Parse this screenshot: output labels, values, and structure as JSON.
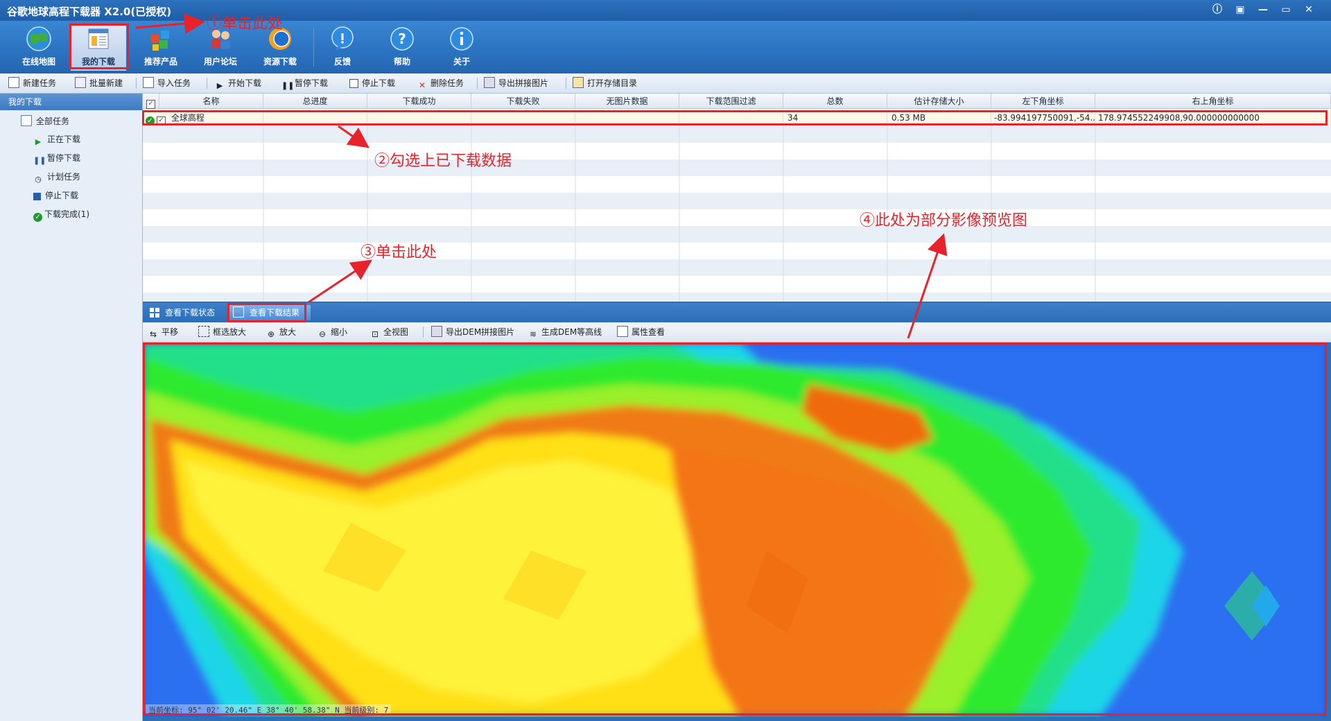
{
  "window": {
    "title": "谷歌地球高程下载器 X2.0(已授权)",
    "controls": [
      "info-icon",
      "skin-icon",
      "minimize-icon",
      "maximize-icon",
      "close-icon"
    ]
  },
  "main_toolbar": {
    "buttons": [
      {
        "label": "在线地图",
        "icon": "globe-icon"
      },
      {
        "label": "我的下载",
        "icon": "download-list-icon"
      },
      {
        "label": "推荐产品",
        "icon": "cubes-icon"
      },
      {
        "label": "用户论坛",
        "icon": "users-icon"
      },
      {
        "label": "资源下载",
        "icon": "resource-icon"
      },
      {
        "label": "反馈",
        "icon": "feedback-icon"
      },
      {
        "label": "帮助",
        "icon": "help-icon"
      },
      {
        "label": "关于",
        "icon": "about-icon"
      }
    ]
  },
  "task_toolbar": {
    "buttons": [
      "新建任务",
      "批量新建",
      "导入任务",
      "开始下载",
      "暂停下载",
      "停止下载",
      "删除任务",
      "导出拼接图片",
      "打开存储目录"
    ]
  },
  "left_panel": {
    "header": "我的下载",
    "tree": [
      {
        "label": "全部任务",
        "icon": "list-icon"
      },
      {
        "label": "正在下载",
        "icon": "play-icon"
      },
      {
        "label": "暂停下载",
        "icon": "pause-icon"
      },
      {
        "label": "计划任务",
        "icon": "clock-icon"
      },
      {
        "label": "停止下载",
        "icon": "stop-icon"
      },
      {
        "label": "下载完成(1)",
        "icon": "check-circle-icon"
      }
    ]
  },
  "task_grid": {
    "columns": [
      "名称",
      "总进度",
      "下载成功",
      "下载失败",
      "无图片数据",
      "下载范围过滤",
      "总数",
      "估计存储大小",
      "左下角坐标",
      "右上角坐标"
    ],
    "rows": [
      {
        "name": "全球高程",
        "progress": "",
        "success": "",
        "failed": "",
        "no_image": "",
        "filter": "",
        "total": "34",
        "size": "0.53 MB",
        "bottom_left": "-83.994197750091,-54...",
        "top_right": "178.974552249908,90.000000000000",
        "checked": true,
        "done": true
      }
    ]
  },
  "result_tabs": {
    "tabs": [
      "查看下载状态",
      "查看下载结果"
    ],
    "selected": 1
  },
  "map_toolbar": {
    "buttons": [
      "平移",
      "框选放大",
      "放大",
      "缩小",
      "全视图",
      "导出DEM拼接图片",
      "生成DEM等高线",
      "属性查看"
    ]
  },
  "map": {
    "status": "当前坐标:   95° 02' 20.46\" E 38° 40' 58.38\" N  当前级别: 7"
  },
  "annotations": {
    "a1": "①单击此处",
    "a2": "②勾选上已下载数据",
    "a3": "③单击此处",
    "a4": "④此处为部分影像预览图"
  },
  "colors": {
    "annotation": "#e8212a",
    "toolbar": "#2b72c0"
  }
}
